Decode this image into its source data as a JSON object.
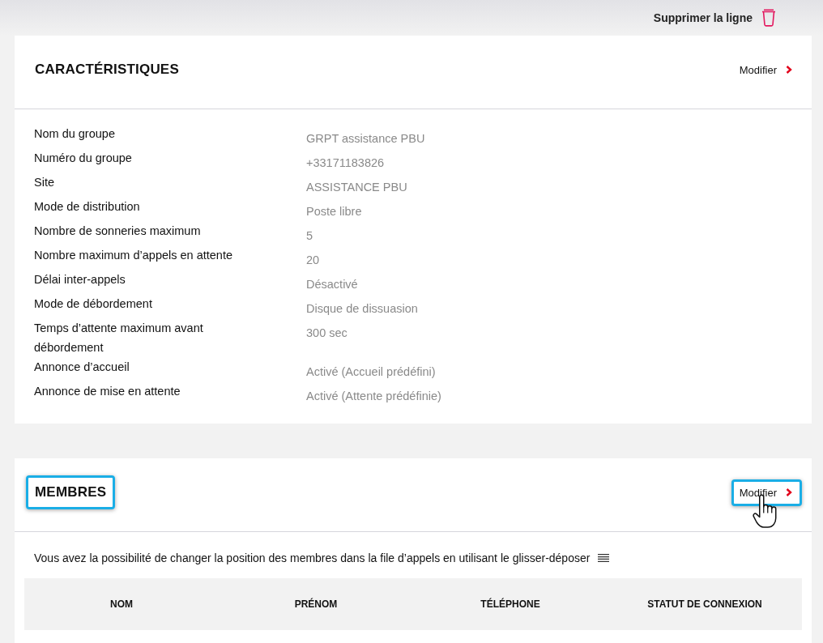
{
  "toolbar": {
    "delete_label": "Supprimer la ligne"
  },
  "sections": [
    {
      "kind": "details",
      "title": "CARACTÉRISTIQUES",
      "title_highlighted": false,
      "edit": {
        "label": "Modifier",
        "highlighted": false,
        "hovered": false
      },
      "fields": [
        {
          "label": "Nom du groupe",
          "value": "GRPT assistance PBU"
        },
        {
          "label": "Numéro du groupe",
          "value": "+33171183826"
        },
        {
          "label": "Site",
          "value": "ASSISTANCE PBU"
        },
        {
          "label": "Mode de distribution",
          "value": "Poste libre"
        },
        {
          "label": "Nombre de sonneries maximum",
          "value": "5"
        },
        {
          "label": "Nombre maximum d’appels en attente",
          "value": "20"
        },
        {
          "label": "Délai inter-appels",
          "value": "Désactivé"
        },
        {
          "label": "Mode de débordement",
          "value": "Disque de dissuasion"
        },
        {
          "label": "Temps d’attente maximum avant débordement",
          "value": "300 sec"
        },
        {
          "label": "Annonce d’accueil",
          "value": "Activé (Accueil prédéfini)"
        },
        {
          "label": "Annonce de mise en attente",
          "value": "Activé (Attente prédéfinie)"
        }
      ]
    },
    {
      "kind": "members",
      "title": "MEMBRES",
      "title_highlighted": true,
      "edit": {
        "label": "Modifier",
        "highlighted": true,
        "hovered": true
      },
      "hint": "Vous avez la possibilité de changer la position des membres dans la file d’appels en utilisant le glisser-déposer",
      "table": {
        "columns": [
          "NOM",
          "PRÉNOM",
          "TÉLÉPHONE",
          "STATUT DE CONNEXION"
        ]
      }
    }
  ]
}
